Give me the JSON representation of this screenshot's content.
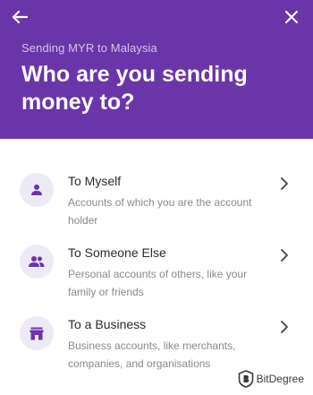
{
  "header": {
    "subtitle": "Sending MYR to Malaysia",
    "title": "Who are you sending money to?",
    "background_color": "#6a35a8",
    "back_icon": "arrow-left-icon",
    "close_icon": "close-icon"
  },
  "options": [
    {
      "icon": "person-icon",
      "title": "To Myself",
      "description": "Accounts of which you are the account holder"
    },
    {
      "icon": "people-icon",
      "title": "To Someone Else",
      "description": "Personal accounts of others, like your family or friends"
    },
    {
      "icon": "store-icon",
      "title": "To a Business",
      "description": "Business accounts, like merchants, companies, and organisations"
    }
  ],
  "watermark": {
    "text": "BitDegree"
  },
  "colors": {
    "accent": "#6a35a8",
    "icon_bg": "#eeeaf5",
    "title_text": "#2b2b2b",
    "desc_text": "#8a8a8a"
  }
}
